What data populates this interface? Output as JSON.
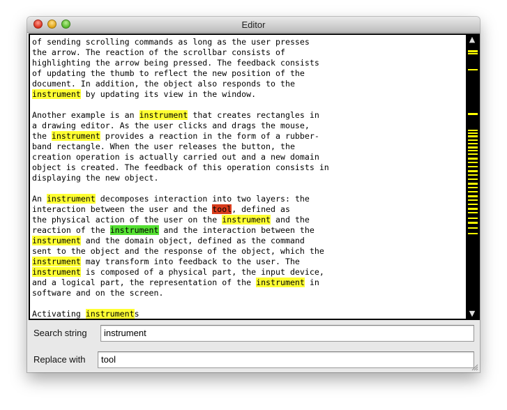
{
  "window": {
    "title": "Editor"
  },
  "editor": {
    "lines": [
      [
        {
          "t": "of sending scrolling commands as long as the user presses"
        }
      ],
      [
        {
          "t": "the arrow. The reaction of the scrollbar consists of"
        }
      ],
      [
        {
          "t": "highlighting the arrow being pressed. The feedback consists"
        }
      ],
      [
        {
          "t": "of updating the thumb to reflect the new position of the"
        }
      ],
      [
        {
          "t": "document. In addition, the object also responds to the"
        }
      ],
      [
        {
          "t": "instrument",
          "h": "y"
        },
        {
          "t": " by updating its view in the window."
        }
      ],
      [
        {
          "t": ""
        }
      ],
      [
        {
          "t": "Another example is an "
        },
        {
          "t": "instrument",
          "h": "y"
        },
        {
          "t": " that creates rectangles in"
        }
      ],
      [
        {
          "t": "a drawing editor. As the user clicks and drags the mouse,"
        }
      ],
      [
        {
          "t": "the "
        },
        {
          "t": "instrument",
          "h": "y"
        },
        {
          "t": " provides a reaction in the form of a rubber-"
        }
      ],
      [
        {
          "t": "band rectangle. When the user releases the button, the"
        }
      ],
      [
        {
          "t": "creation operation is actually carried out and a new domain"
        }
      ],
      [
        {
          "t": "object is created. The feedback of this operation consists in"
        }
      ],
      [
        {
          "t": "displaying the new object."
        }
      ],
      [
        {
          "t": ""
        }
      ],
      [
        {
          "t": "An "
        },
        {
          "t": "instrument",
          "h": "y"
        },
        {
          "t": " decomposes interaction into two layers: the"
        }
      ],
      [
        {
          "t": "interaction between the user and the "
        },
        {
          "t": "tool",
          "h": "r"
        },
        {
          "t": ", defined as"
        }
      ],
      [
        {
          "t": "the physical action of the user on the "
        },
        {
          "t": "instrument",
          "h": "y"
        },
        {
          "t": " and the"
        }
      ],
      [
        {
          "t": "reaction of the "
        },
        {
          "t": "instrument",
          "h": "g"
        },
        {
          "t": " and the interaction between the"
        }
      ],
      [
        {
          "t": "instrument",
          "h": "y"
        },
        {
          "t": " and the domain object, defined as the command"
        }
      ],
      [
        {
          "t": "sent to the object and the response of the object, which the"
        }
      ],
      [
        {
          "t": "instrument",
          "h": "y"
        },
        {
          "t": " may transform into feedback to the user. The"
        }
      ],
      [
        {
          "t": "instrument",
          "h": "y"
        },
        {
          "t": " is composed of a physical part, the input device,"
        }
      ],
      [
        {
          "t": "and a logical part, the representation of the "
        },
        {
          "t": "instrument",
          "h": "y"
        },
        {
          "t": " in"
        }
      ],
      [
        {
          "t": "software and on the screen."
        }
      ],
      [
        {
          "t": ""
        }
      ],
      [
        {
          "t": "Activating "
        },
        {
          "t": "instrument",
          "h": "y"
        },
        {
          "t": "s"
        }
      ]
    ],
    "highlight_colors": {
      "match": "#ffff33",
      "current": "#55e033",
      "replaced": "#d83c1c"
    }
  },
  "scrollbar": {
    "up_arrow_icon": "triangle-up-icon",
    "down_arrow_icon": "triangle-down-icon",
    "marker_color": "#ffff00"
  },
  "search": {
    "label": "Search string",
    "value": "instrument"
  },
  "replace": {
    "label": "Replace with",
    "value": "tool"
  },
  "grip": {
    "icon": "resize-grip-icon"
  }
}
